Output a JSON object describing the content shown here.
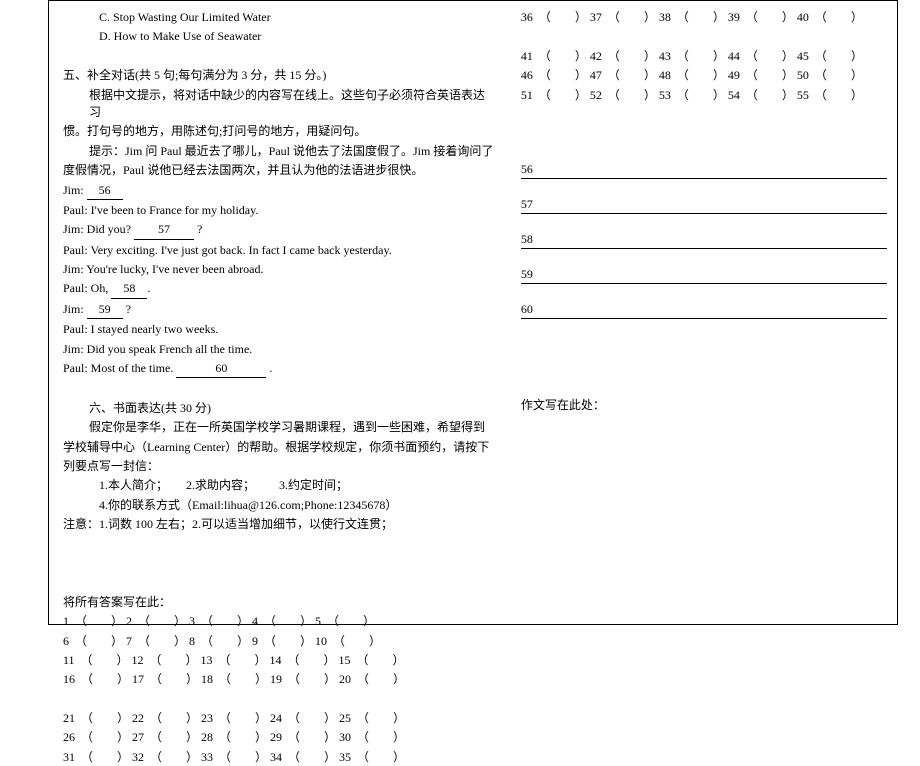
{
  "left": {
    "optC": "C. Stop Wasting Our Limited Water",
    "optD": "D. How to Make Use of Seawater",
    "sec5": {
      "title": "五、补全对话(共 5 句;每句满分为 3 分，共 15 分。)",
      "inst1": "根据中文提示，将对话中缺少的内容写在线上。这些句子必须符合英语表达习",
      "inst2": "惯。打句号的地方，用陈述句;打问号的地方，用疑问句。",
      "hint1": "提示：Jim 问 Paul 最近去了哪儿，Paul 说他去了法国度假了。Jim 接着询问了",
      "hint2": "度假情况，Paul 说他已经去法国两次，并且认为他的法语进步很快。"
    },
    "dlg": {
      "jim1a": "Jim:",
      "b56": "56",
      "paul1": "Paul: I've been to France for my holiday.",
      "jim2a": "Jim: Did you?",
      "b57": "57",
      "jim2b": "?",
      "paul2": "Paul: Very exciting. I've just got back. In fact I came back yesterday.",
      "jim3": "Jim: You're lucky, I've never been abroad.",
      "paul3a": "Paul: Oh,",
      "b58": "58",
      "paul3b": ".",
      "jim4a": "Jim:",
      "b59": "59",
      "jim4b": "?",
      "paul4": "Paul: I stayed nearly two weeks.",
      "jim5": "Jim: Did you speak French all the time.",
      "paul5a": "Paul: Most of the time.",
      "b60": "60",
      "paul5b": "."
    },
    "sec6": {
      "title": "六、书面表达(共 30 分)",
      "p1": "假定你是李华，正在一所英国学校学习暑期课程，遇到一些困难，希望得到",
      "p2": "学校辅导中心（Learning Center）的帮助。根据学校规定，你须书面预约，请按下",
      "p3": "列要点写一封信：",
      "li1": "1.本人简介；",
      "li2": "2.求助内容；",
      "li3": "3.约定时间；",
      "li4": "4.你的联系方式（Email:lihua@126.com;Phone:12345678）",
      "note": "注意：1.词数 100 左右；2.可以适当增加细节，以使行文连贯；"
    },
    "ans": {
      "title": "将所有答案写在此：",
      "rowsLeft": [
        [
          1,
          2,
          3,
          4,
          5
        ],
        [
          6,
          7,
          8,
          9,
          10
        ],
        [
          11,
          12,
          13,
          14,
          15
        ],
        [
          16,
          17,
          18,
          19,
          20
        ],
        [
          21,
          22,
          23,
          24,
          25
        ],
        [
          26,
          27,
          28,
          29,
          30
        ],
        [
          31,
          32,
          33,
          34,
          35
        ]
      ]
    }
  },
  "right": {
    "rows": [
      [
        36,
        37,
        38,
        39,
        40
      ],
      [
        41,
        42,
        43,
        44,
        45
      ],
      [
        46,
        47,
        48,
        49,
        50
      ],
      [
        51,
        52,
        53,
        54,
        55
      ]
    ],
    "longBlanks": [
      "56",
      "57",
      "58",
      "59",
      "60"
    ],
    "essayHere": "作文写在此处："
  }
}
